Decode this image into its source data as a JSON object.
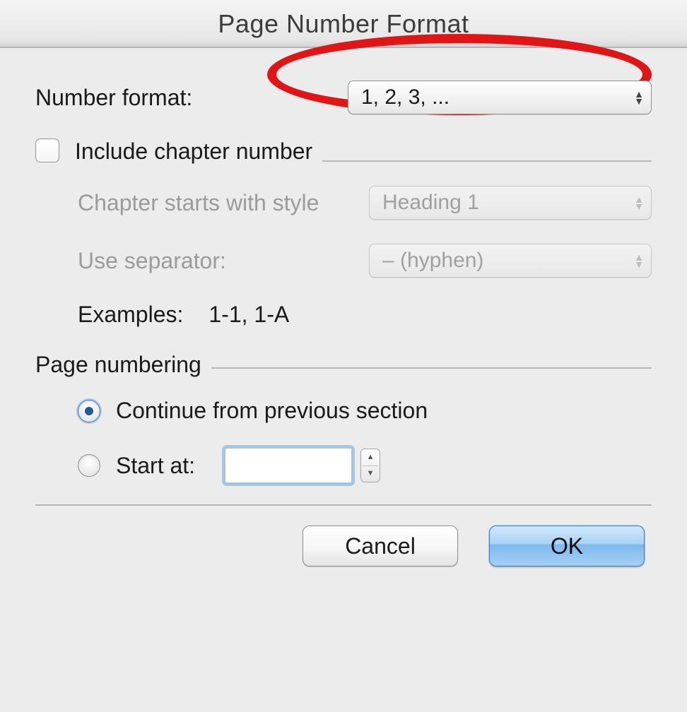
{
  "title": "Page Number Format",
  "number_format": {
    "label": "Number format:",
    "value": "1, 2, 3, ..."
  },
  "include_chapter": {
    "label": "Include chapter number",
    "checked": false
  },
  "chapter_style": {
    "label": "Chapter starts with style",
    "value": "Heading 1"
  },
  "use_separator": {
    "label": "Use separator:",
    "value": "–   (hyphen)"
  },
  "examples": {
    "label": "Examples:",
    "value": "1-1, 1-A"
  },
  "page_numbering": {
    "header": "Page numbering",
    "continue_label": "Continue from previous section",
    "start_at_label": "Start at:",
    "start_at_value": "",
    "selected": "continue"
  },
  "buttons": {
    "cancel": "Cancel",
    "ok": "OK"
  }
}
